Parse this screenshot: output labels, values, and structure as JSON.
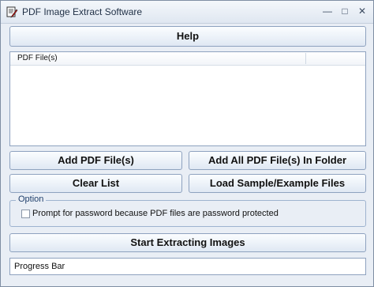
{
  "window": {
    "title": "PDF Image Extract Software",
    "controls": {
      "minimize": "—",
      "maximize": "□",
      "close": "✕"
    }
  },
  "buttons": {
    "help": "Help",
    "add_files": "Add PDF File(s)",
    "add_folder": "Add All PDF File(s) In Folder",
    "clear_list": "Clear List",
    "load_samples": "Load Sample/Example Files",
    "start": "Start Extracting Images"
  },
  "file_list": {
    "column_header": "PDF File(s)",
    "items": []
  },
  "options": {
    "group_title": "Option",
    "password_checkbox": {
      "label": "Prompt for password because PDF files are password protected",
      "checked": false
    }
  },
  "progress": {
    "label": "Progress Bar",
    "fraction": 0
  },
  "icons": {
    "app": "document-pen-icon"
  },
  "colors": {
    "button_border": "#8ea2bf",
    "group_title": "#1f3f6b"
  }
}
